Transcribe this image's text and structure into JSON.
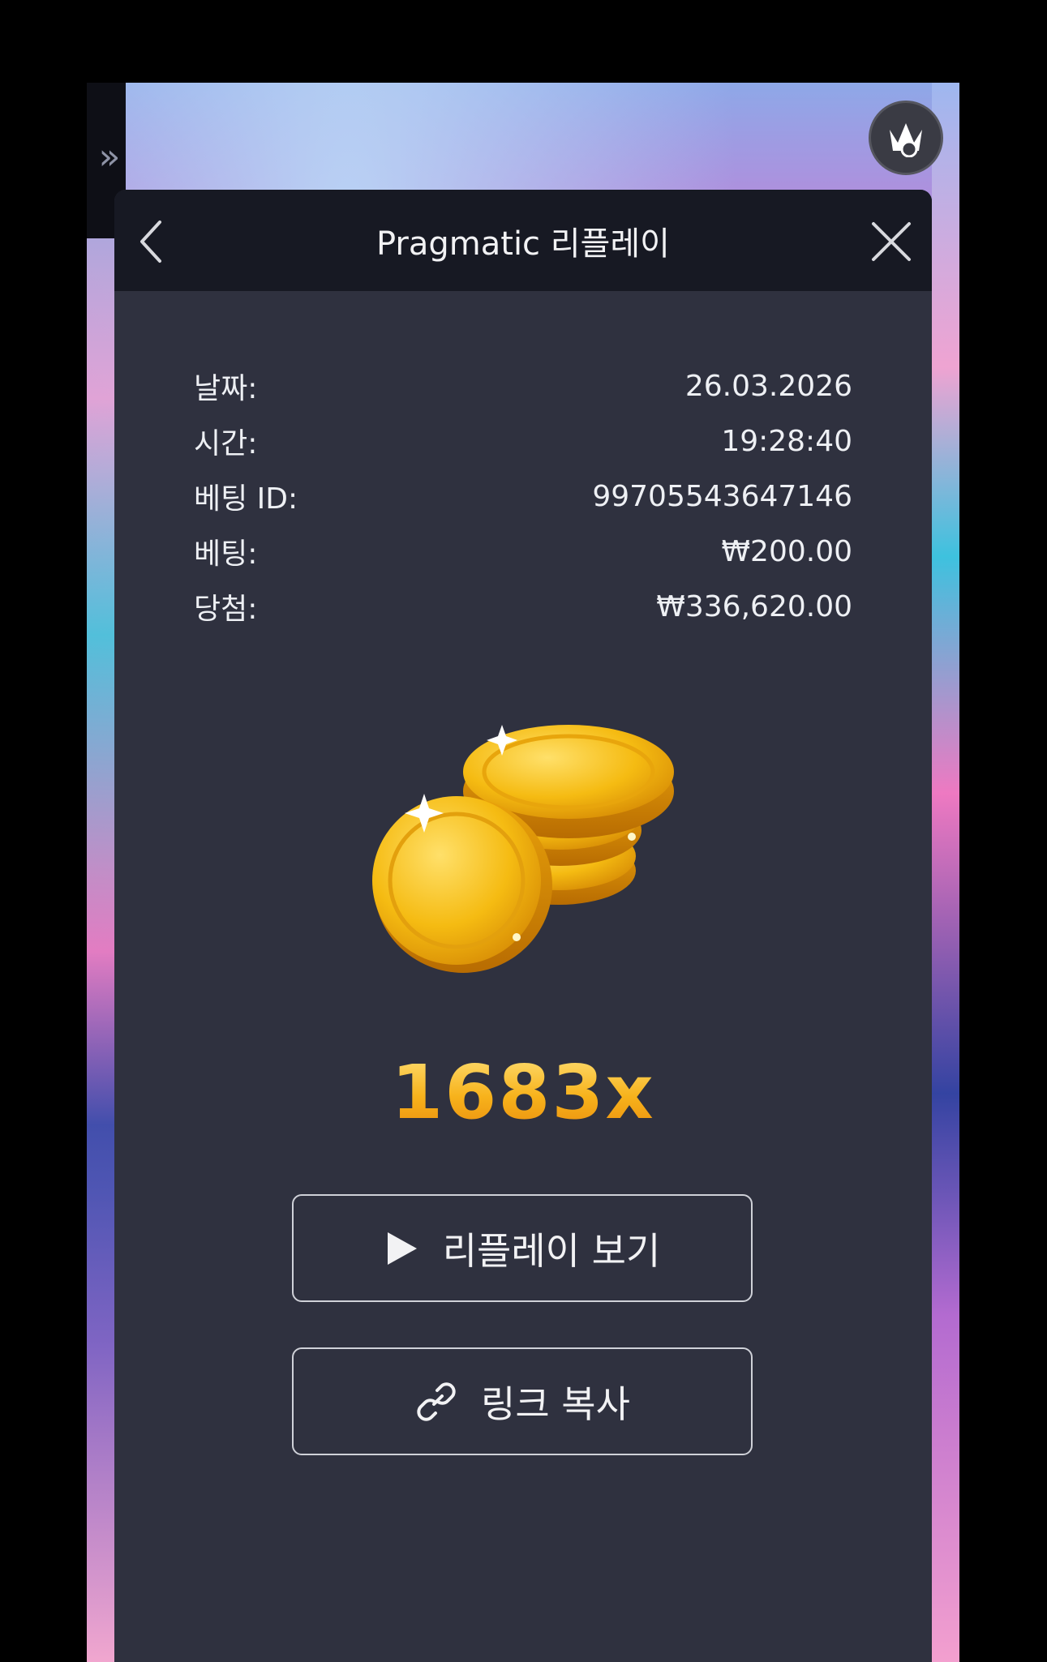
{
  "side_tab": {
    "icon": "double-chevron-right-icon",
    "glyph": "»"
  },
  "crown_button": {
    "icon": "crown-icon"
  },
  "header": {
    "title": "Pragmatic 리플레이",
    "back_icon": "chevron-left-icon",
    "close_icon": "close-icon"
  },
  "details": [
    {
      "label": "날짜:",
      "value": "26.03.2026"
    },
    {
      "label": "시간:",
      "value": "19:28:40"
    },
    {
      "label": "베팅 ID:",
      "value": "99705543647146"
    },
    {
      "label": "베팅:",
      "value": "₩200.00"
    },
    {
      "label": "당첨:",
      "value": "₩336,620.00"
    }
  ],
  "illustration": {
    "icon": "gold-coins-icon"
  },
  "multiplier": "1683x",
  "buttons": {
    "replay": {
      "label": "리플레이 보기",
      "icon": "play-icon"
    },
    "copy_link": {
      "label": "링크 복사",
      "icon": "link-icon"
    }
  },
  "colors": {
    "modal_bg": "#2f313f",
    "header_bg": "#171923",
    "multiplier_gold": "#f6b51d"
  }
}
